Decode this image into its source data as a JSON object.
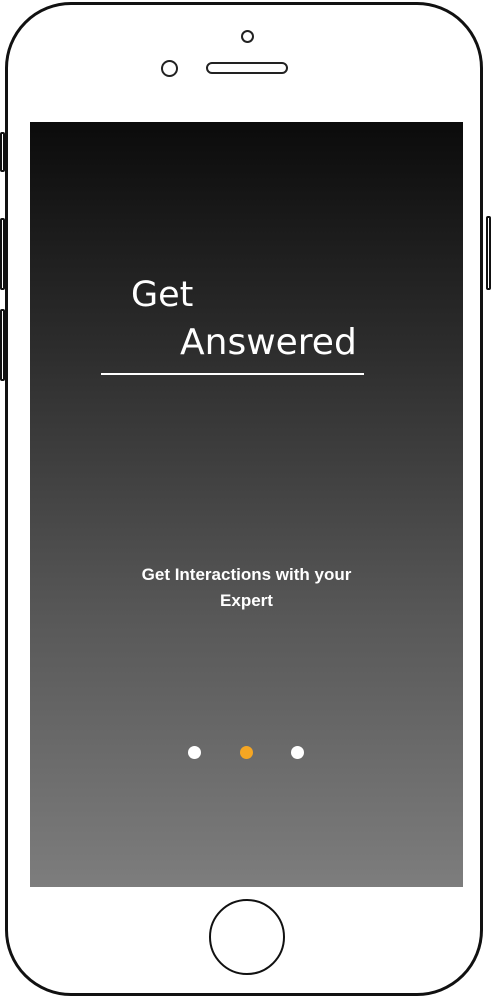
{
  "onboarding": {
    "title_line1": "Get",
    "title_line2": "Answered",
    "subtitle_line1": "Get Interactions with your",
    "subtitle_line2": "Expert",
    "page_indicator": {
      "total": 3,
      "active_index": 1
    }
  },
  "colors": {
    "accent": "#f5a623",
    "dot_inactive": "#ffffff",
    "text": "#ffffff"
  },
  "icons": {
    "home": "home-button-icon",
    "camera": "front-camera-icon",
    "speaker": "earpiece-speaker-icon"
  }
}
